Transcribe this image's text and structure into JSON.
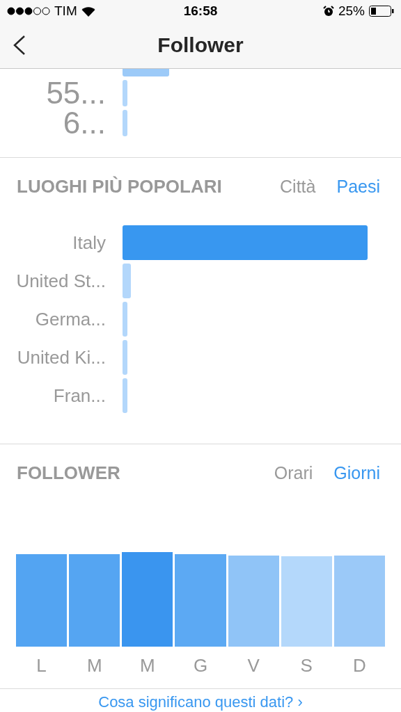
{
  "status_bar": {
    "carrier": "TIM",
    "time": "16:58",
    "battery": "25%"
  },
  "nav": {
    "title": "Follower"
  },
  "partial_chart": {
    "rows": [
      {
        "label": null
      },
      {
        "label": "55..."
      },
      {
        "label": "6..."
      }
    ]
  },
  "places": {
    "title": "LUOGHI PIÙ POPOLARI",
    "tabs": [
      {
        "label": "Città",
        "selected": false
      },
      {
        "label": "Paesi",
        "selected": true
      }
    ],
    "rows": [
      {
        "label": "Italy",
        "color": "#3897f0"
      },
      {
        "label": "United St...",
        "color": "#b3d7fb"
      },
      {
        "label": "Germa...",
        "color": "#b3d7fb"
      },
      {
        "label": "United Ki...",
        "color": "#b3d7fb"
      },
      {
        "label": "Fran...",
        "color": "#b3d7fb"
      }
    ]
  },
  "followers": {
    "title": "FOLLOWER",
    "tabs": [
      {
        "label": "Orari",
        "selected": false
      },
      {
        "label": "Giorni",
        "selected": true
      }
    ],
    "days": [
      {
        "label": "L",
        "color": "#53a4f2"
      },
      {
        "label": "M",
        "color": "#55a5f2"
      },
      {
        "label": "M",
        "color": "#3a95ef"
      },
      {
        "label": "G",
        "color": "#5ca9f3"
      },
      {
        "label": "V",
        "color": "#90c4f7"
      },
      {
        "label": "S",
        "color": "#b4d8fb"
      },
      {
        "label": "D",
        "color": "#9bc9f8"
      }
    ]
  },
  "footer_link": "Cosa significano questi dati? ›"
}
